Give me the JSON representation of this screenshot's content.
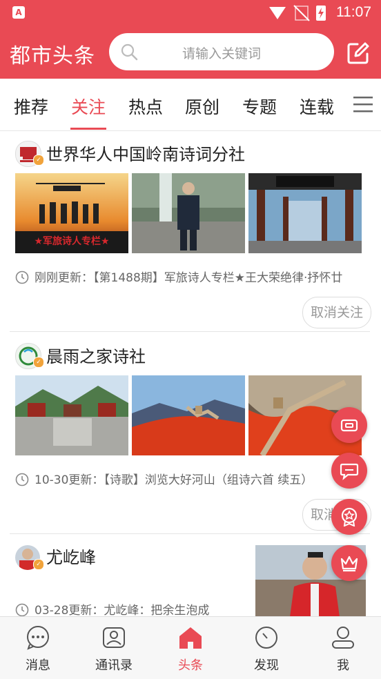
{
  "status_bar": {
    "time": "11:07",
    "app_badge": "A"
  },
  "header": {
    "app_title": "都市头条",
    "search_placeholder": "请输入关键词"
  },
  "tabs": [
    {
      "label": "推荐"
    },
    {
      "label": "关注",
      "active": true
    },
    {
      "label": "热点"
    },
    {
      "label": "原创"
    },
    {
      "label": "专题"
    },
    {
      "label": "连载"
    }
  ],
  "feed": [
    {
      "name": "世界华人中国岭南诗词分社",
      "banner_text": "★军旅诗人专栏★",
      "update": "刚刚更新：【第1488期】军旅诗人专栏★王大荣绝律·抒怀廿",
      "unfollow": "取消关注"
    },
    {
      "name": "晨雨之家诗社",
      "update": "10-30更新：【诗歌】浏览大好河山（组诗六首 续五）",
      "unfollow": "取消关注"
    },
    {
      "name": "尤屹峰",
      "update": "03-28更新：尤屹峰：把余生泡成"
    }
  ],
  "bottom_nav": [
    {
      "label": "消息"
    },
    {
      "label": "通讯录"
    },
    {
      "label": "头条",
      "active": true
    },
    {
      "label": "发现"
    },
    {
      "label": "我"
    }
  ],
  "colors": {
    "accent": "#e94a54",
    "badge": "#f1a33b"
  }
}
